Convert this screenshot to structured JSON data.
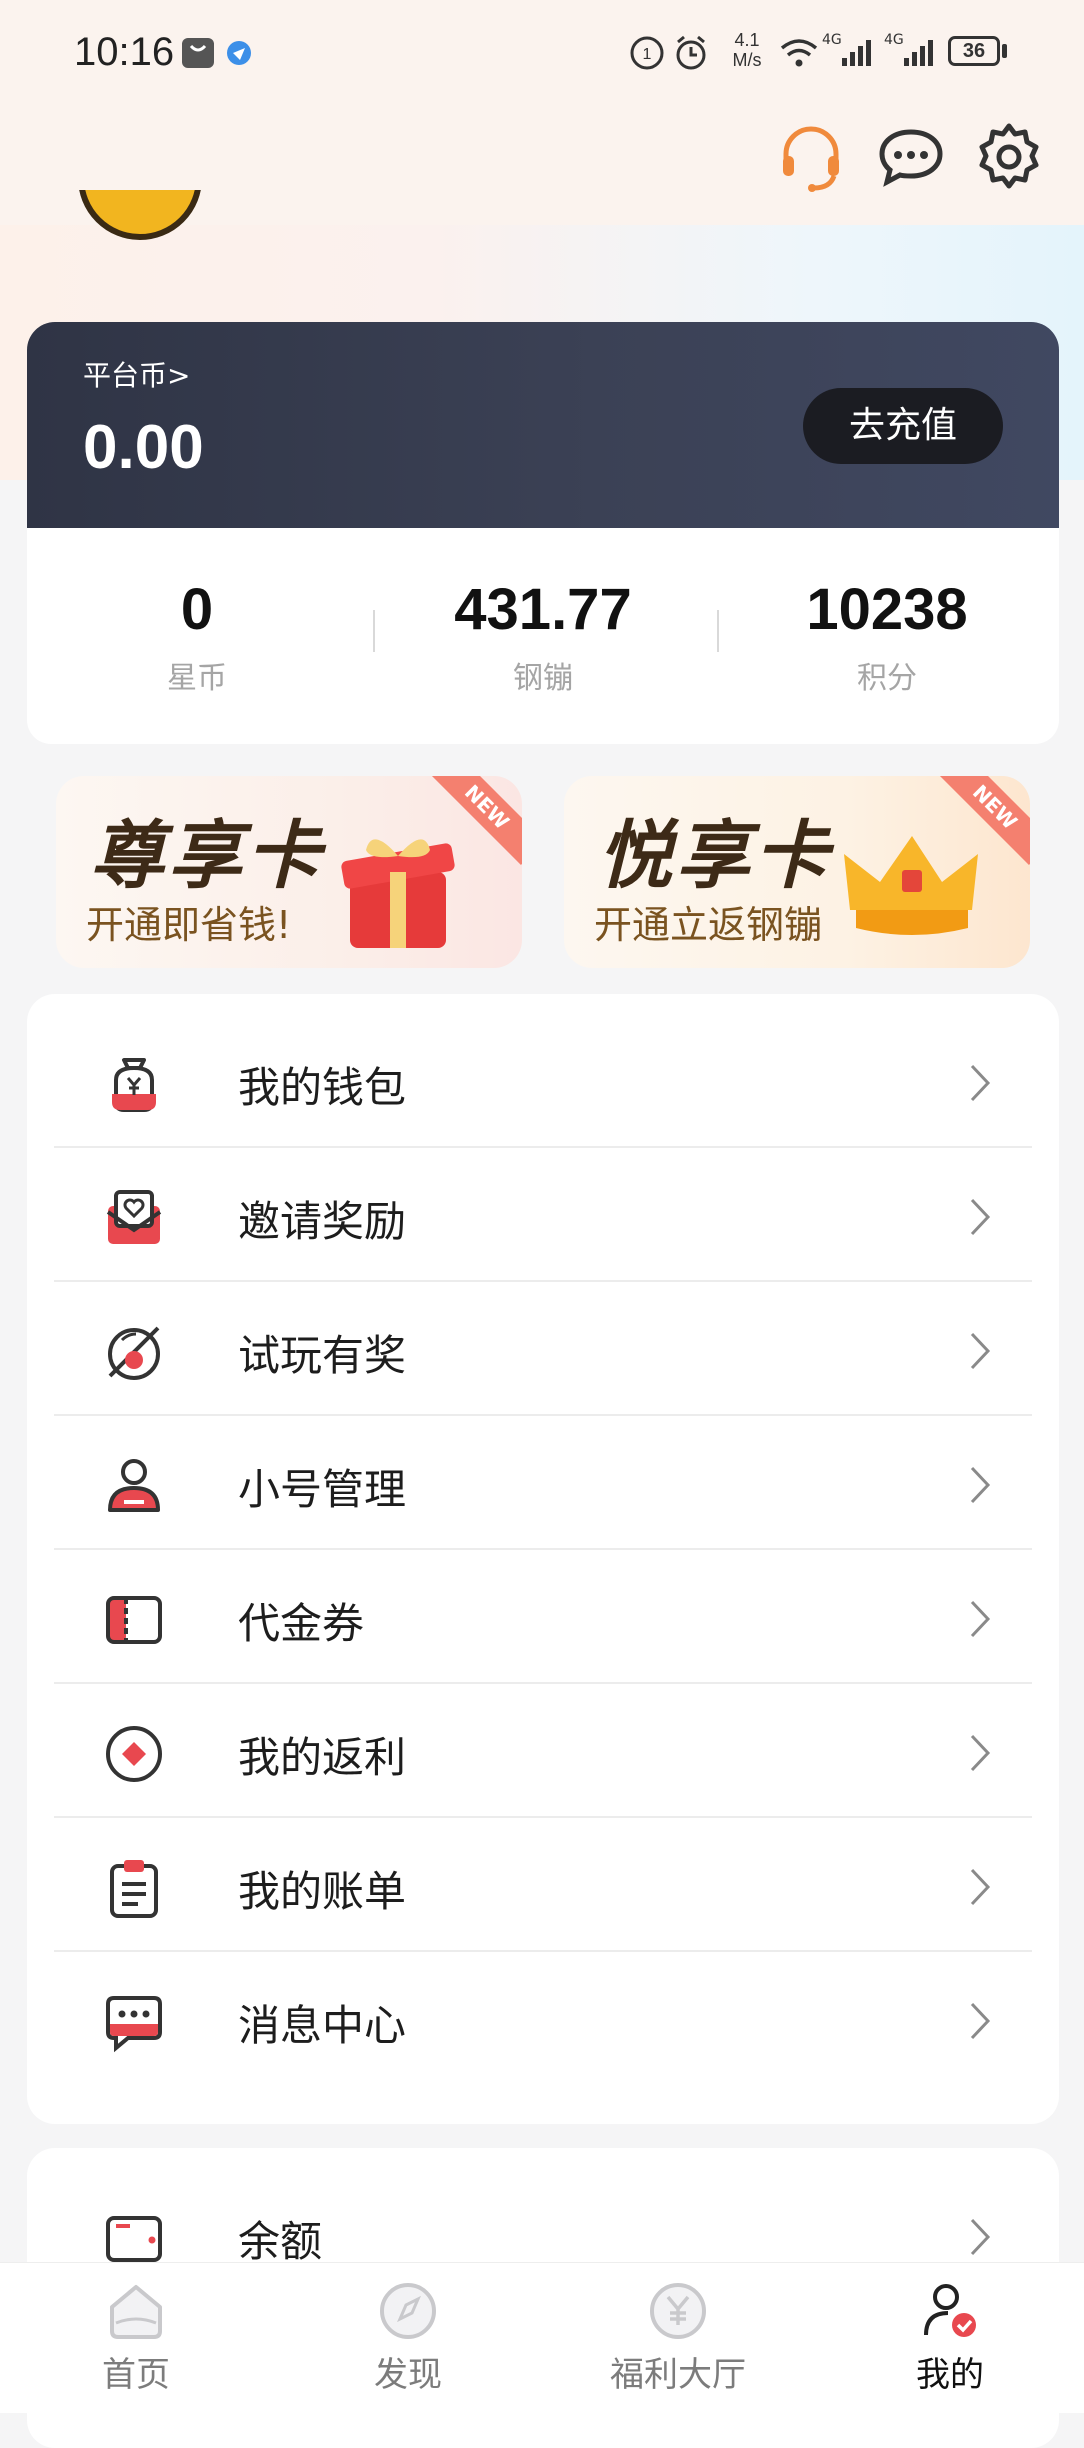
{
  "status_bar": {
    "time": "10:16",
    "net_speed_value": "4.1",
    "net_speed_unit": "M/s",
    "signal1_label": "4G",
    "signal2_label": "4G",
    "battery": "36"
  },
  "balance": {
    "platform_coin_label": "平台币>",
    "platform_coin_value": "0.00",
    "recharge_label": "去充值"
  },
  "stats": [
    {
      "value": "0",
      "label": "星币"
    },
    {
      "value": "431.77",
      "label": "钢镚"
    },
    {
      "value": "10238",
      "label": "积分"
    }
  ],
  "promos": [
    {
      "title": "尊享卡",
      "subtitle": "开通即省钱!",
      "tag": "NEW"
    },
    {
      "title": "悦享卡",
      "subtitle": "开通立返钢镚",
      "tag": "NEW"
    }
  ],
  "menu": [
    {
      "label": "我的钱包",
      "icon": "wallet-bag-icon"
    },
    {
      "label": "邀请奖励",
      "icon": "invite-envelope-icon"
    },
    {
      "label": "试玩有奖",
      "icon": "trial-play-icon"
    },
    {
      "label": "小号管理",
      "icon": "account-manage-icon"
    },
    {
      "label": "代金券",
      "icon": "voucher-icon"
    },
    {
      "label": "我的返利",
      "icon": "rebate-icon"
    },
    {
      "label": "我的账单",
      "icon": "bill-clipboard-icon"
    },
    {
      "label": "消息中心",
      "icon": "message-center-icon"
    }
  ],
  "menu2": [
    {
      "label": "余额",
      "icon": "balance-card-icon"
    }
  ],
  "bottom_nav": [
    {
      "label": "首页",
      "icon": "home-icon",
      "active": false
    },
    {
      "label": "发现",
      "icon": "compass-icon",
      "active": false
    },
    {
      "label": "福利大厅",
      "icon": "yuan-coin-icon",
      "active": false
    },
    {
      "label": "我的",
      "icon": "profile-icon",
      "active": true
    }
  ],
  "colors": {
    "accent_red": "#e8484f",
    "header_icon_orange": "#f08a3c",
    "card_dark": "#363b4e"
  }
}
